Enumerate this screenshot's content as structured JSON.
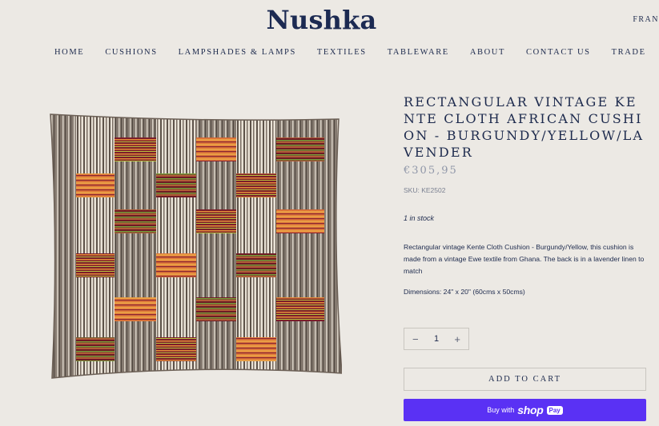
{
  "brand": {
    "logo": "Nushka",
    "region": "FRAN"
  },
  "nav": [
    {
      "label": "HOME"
    },
    {
      "label": "CUSHIONS"
    },
    {
      "label": "LAMPSHADES & LAMPS"
    },
    {
      "label": "TEXTILES"
    },
    {
      "label": "TABLEWARE"
    },
    {
      "label": "ABOUT"
    },
    {
      "label": "CONTACT US"
    },
    {
      "label": "TRADE"
    }
  ],
  "product": {
    "title": "RECTANGULAR VINTAGE KENTE CLOTH AFRICAN CUSHION - BURGUNDY/YELLOW/LAVENDER",
    "price": "€305,95",
    "sku": "SKU: KE2502",
    "stock": "1 in stock",
    "description": "Rectangular vintage Kente Cloth Cushion - Burgundy/Yellow, this cushion is made from a vintage Ewe textile from Ghana. The back is in a lavender linen to match",
    "dimensions": "Dimensions: 24\" x 20\" (60cms x 50cms)"
  },
  "quantity": {
    "minus": "−",
    "value": "1",
    "plus": "+"
  },
  "buttons": {
    "add_to_cart": "ADD TO CART",
    "shop_pay_prefix": "Buy with",
    "shop_pay_brand": "shop",
    "shop_pay_badge": "Pay"
  },
  "colors": {
    "background": "#ece9e4",
    "text": "#1d2a4d",
    "shop_pay": "#5a31f4"
  }
}
